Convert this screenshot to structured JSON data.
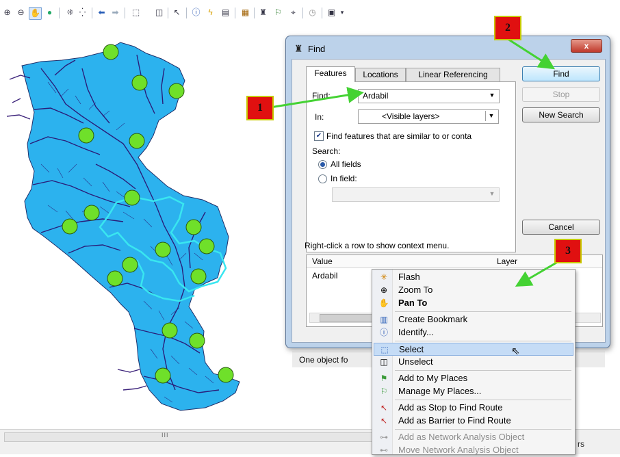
{
  "toolbar": {
    "icons": [
      "zoom-in-icon",
      "zoom-out-icon",
      "pan-icon",
      "full-extent-icon",
      "fixed-zoom-in-icon",
      "fixed-zoom-out-icon",
      "back-icon",
      "forward-icon",
      "select-features-icon",
      "clear-selection-icon",
      "select-elements-icon",
      "identify-icon",
      "hyperlink-icon",
      "html-popup-icon",
      "measure-icon",
      "find-icon",
      "find-route-icon",
      "go-to-xy-icon",
      "time-slider-icon",
      "viewer-icon",
      "more-icon"
    ]
  },
  "dialog": {
    "title": "Find",
    "close": "x",
    "tabs": [
      "Features",
      "Locations",
      "Linear Referencing"
    ],
    "find_label": "Find:",
    "find_value": "Ardabil",
    "in_label": "In:",
    "in_value": "<Visible layers>",
    "similar_checkbox": "Find features that are similar to or conta",
    "similar_checked": true,
    "search_label": "Search:",
    "all_fields": "All fields",
    "in_field": "In field:",
    "buttons": {
      "find": "Find",
      "stop": "Stop",
      "new_search": "New Search",
      "cancel": "Cancel"
    },
    "hint": "Right-click a row to show context menu.",
    "results": {
      "columns": [
        "Value",
        "Layer"
      ],
      "rows": [
        {
          "value": "Ardabil"
        }
      ]
    },
    "status": "One object fo"
  },
  "context_menu": {
    "items": [
      {
        "label": "Flash",
        "icon": "flash-icon"
      },
      {
        "label": "Zoom To",
        "icon": "zoom-to-icon"
      },
      {
        "label": "Pan To",
        "icon": "pan-to-icon"
      },
      {
        "label": "Create Bookmark",
        "icon": "bookmark-icon"
      },
      {
        "label": "Identify...",
        "icon": "identify-icon"
      },
      {
        "label": "Select",
        "icon": "select-icon"
      },
      {
        "label": "Unselect",
        "icon": "unselect-icon"
      },
      {
        "label": "Add to My Places",
        "icon": "add-place-icon"
      },
      {
        "label": "Manage My Places...",
        "icon": "manage-places-icon"
      },
      {
        "label": "Add as Stop to Find Route",
        "icon": "route-stop-icon"
      },
      {
        "label": "Add as Barrier to Find Route",
        "icon": "route-barrier-icon"
      },
      {
        "label": "Add as Network Analysis Object",
        "icon": "network-object-icon"
      },
      {
        "label": "Move Network Analysis Object",
        "icon": "move-network-icon"
      }
    ]
  },
  "annotations": {
    "one": "1",
    "two": "2",
    "three": "3"
  },
  "statusbar": {
    "grip": "III",
    "right_text": "rs"
  },
  "colors": {
    "map_fill": "#2cb2ee",
    "rivers": "#2a0e6e",
    "points": "#6fe02a",
    "highlight": "#39e6f0",
    "callout": "#e01010",
    "arrow": "#44d233"
  }
}
